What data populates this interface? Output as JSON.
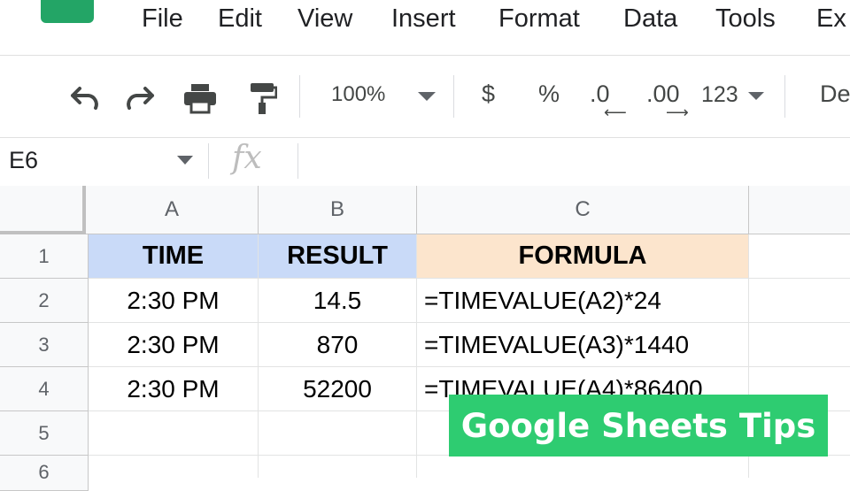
{
  "menu": {
    "items": [
      "File",
      "Edit",
      "View",
      "Insert",
      "Format",
      "Data",
      "Tools",
      "Ex"
    ]
  },
  "toolbar": {
    "zoom": "100%",
    "currency": "$",
    "percent": "%",
    "decrease_decimal": ".0",
    "increase_decimal": ".00",
    "more_formats": "123",
    "font": "De"
  },
  "formula_bar": {
    "cell_ref": "E6",
    "fx": "fx",
    "content": ""
  },
  "sheet": {
    "columns": [
      "A",
      "B",
      "C",
      ""
    ],
    "rows": [
      "1",
      "2",
      "3",
      "4",
      "5",
      "6"
    ],
    "header": {
      "a": "TIME",
      "b": "RESULT",
      "c": "FORMULA"
    },
    "data": [
      {
        "a": "2:30 PM",
        "b": "14.5",
        "c": "=TIMEVALUE(A2)*24"
      },
      {
        "a": "2:30 PM",
        "b": "870",
        "c": "=TIMEVALUE(A3)*1440"
      },
      {
        "a": "2:30 PM",
        "b": "52200",
        "c": "=TIMEVALUE(A4)*86400"
      }
    ],
    "colors": {
      "header_blue": "#c9daf8",
      "header_orange": "#fce5cd"
    }
  },
  "overlay": {
    "text": "Google Sheets Tips",
    "color": "#2ecc71"
  }
}
